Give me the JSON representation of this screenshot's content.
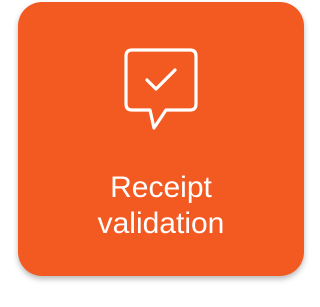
{
  "tile": {
    "label_line1": "Receipt",
    "label_line2": "validation",
    "icon": "chat-checkmark-icon",
    "colors": {
      "background": "#f35a22",
      "foreground": "#ffffff"
    }
  }
}
